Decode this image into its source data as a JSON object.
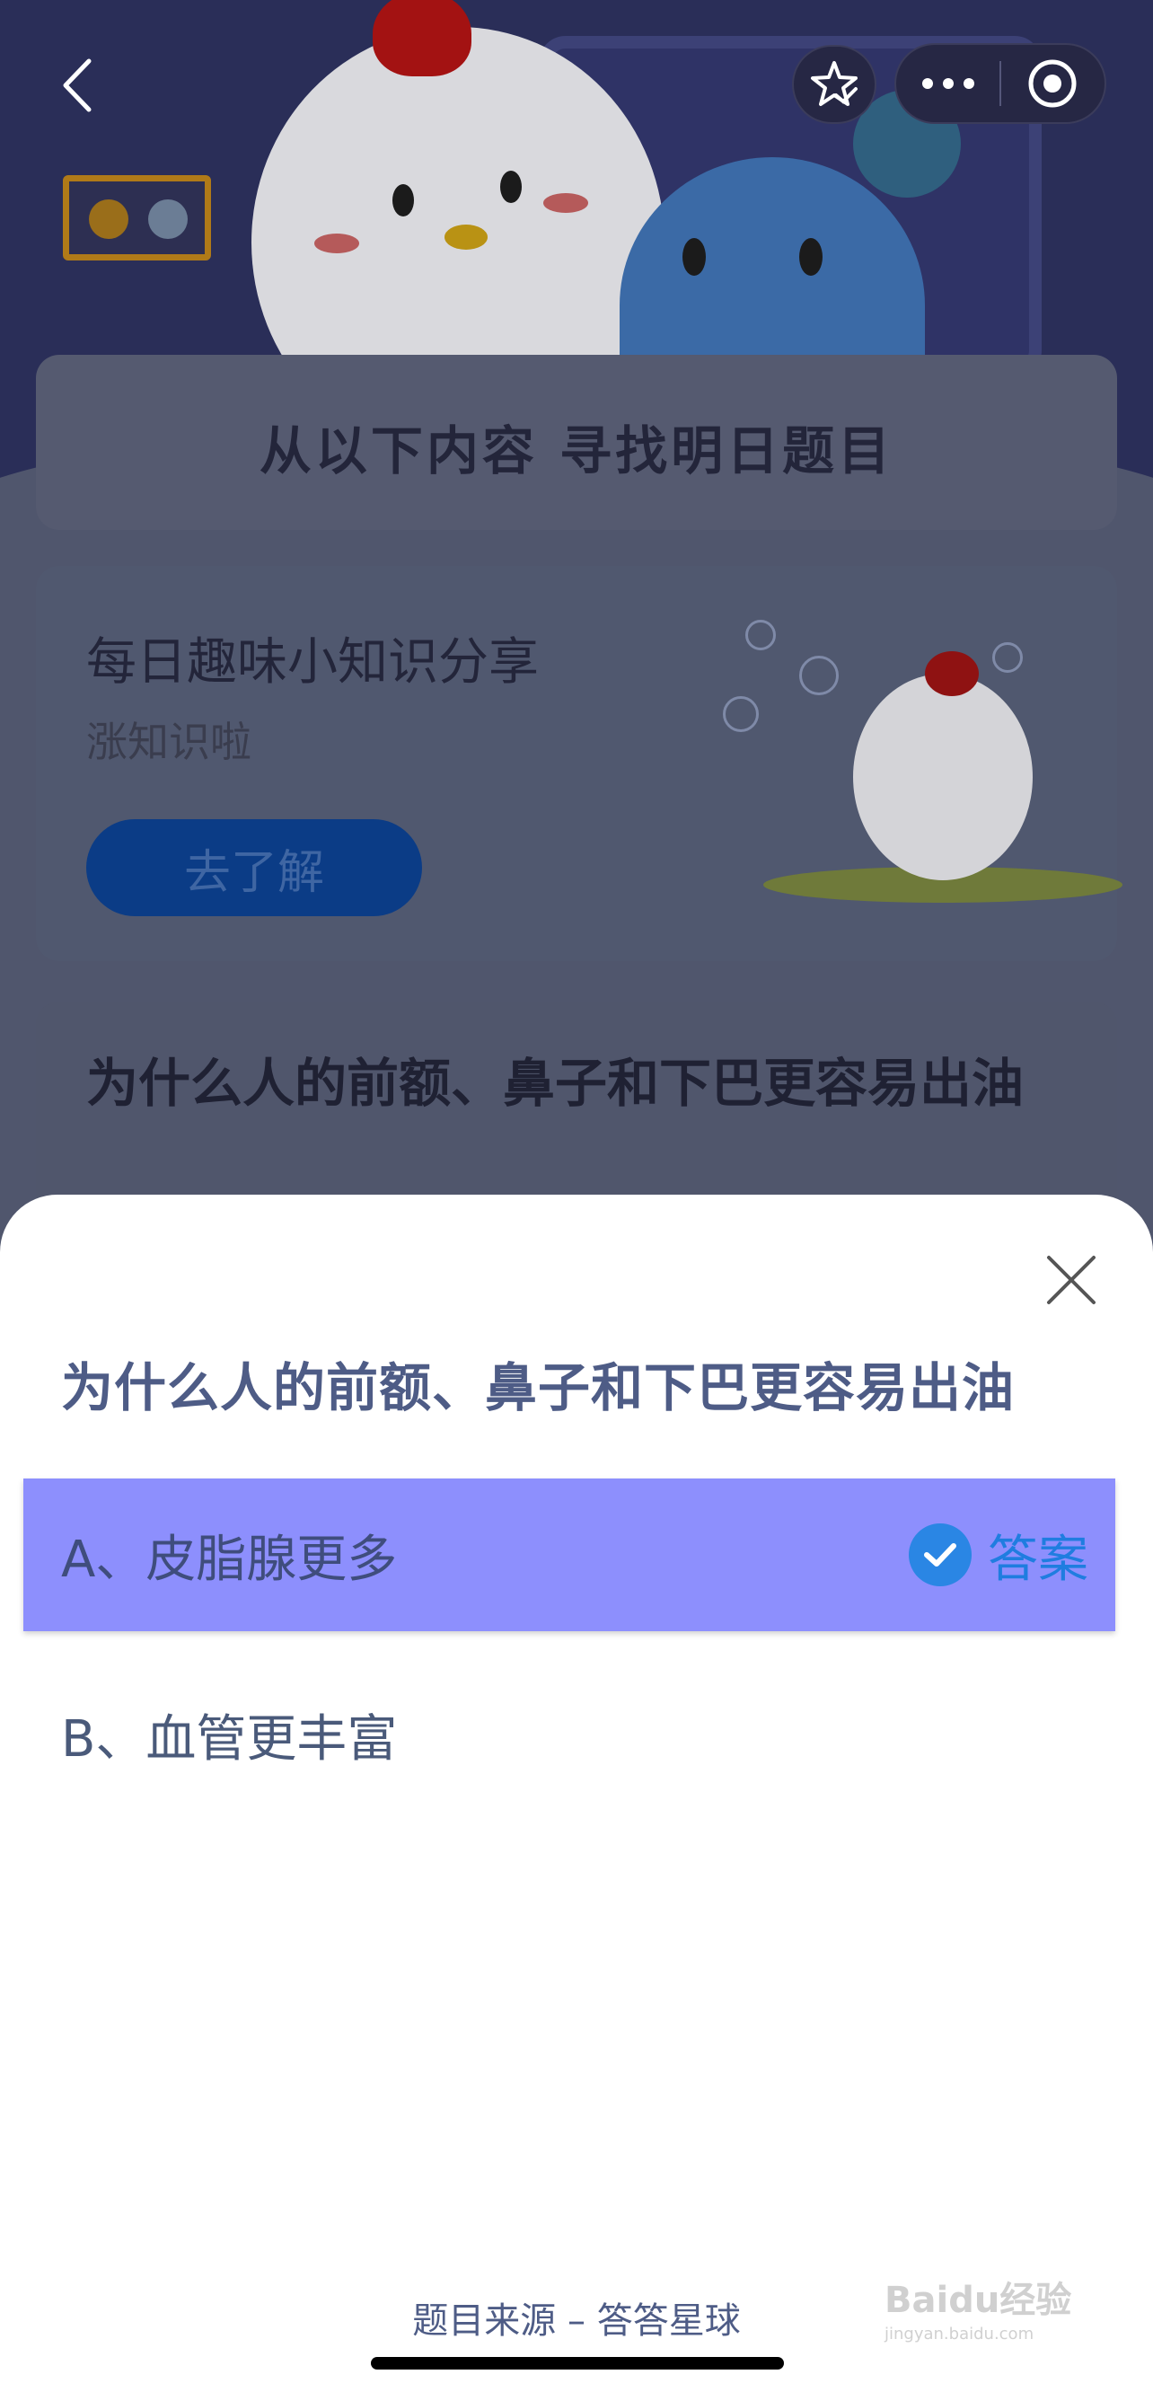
{
  "background": {
    "banner_title": "从以下内容  寻找明日题目",
    "knowledge_card": {
      "title": "每日趣味小知识分享",
      "subtitle": "涨知识啦",
      "button_label": "去了解"
    },
    "question_card": {
      "title": "为什么人的前额、鼻子和下巴更容易出油"
    }
  },
  "nav": {
    "back_icon": "chevron-left-icon",
    "favorite_icon": "star-check-icon",
    "more_icon": "more-dots-icon",
    "close_app_icon": "target-circle-icon"
  },
  "sheet": {
    "question": "为什么人的前额、鼻子和下巴更容易出油",
    "options": [
      {
        "label": "A、皮脂腺更多",
        "is_answer": true
      },
      {
        "label": "B、血管更丰富",
        "is_answer": false
      }
    ],
    "answer_tag": "答案",
    "source": "题目来源 – 答答星球"
  },
  "watermark": {
    "text": "Baidu经验",
    "url_text": "jingyan.baidu.com"
  },
  "colors": {
    "selected_option": "#8d8ffd",
    "answer_blue": "#1f7de0",
    "question_text": "#4e5c86"
  }
}
